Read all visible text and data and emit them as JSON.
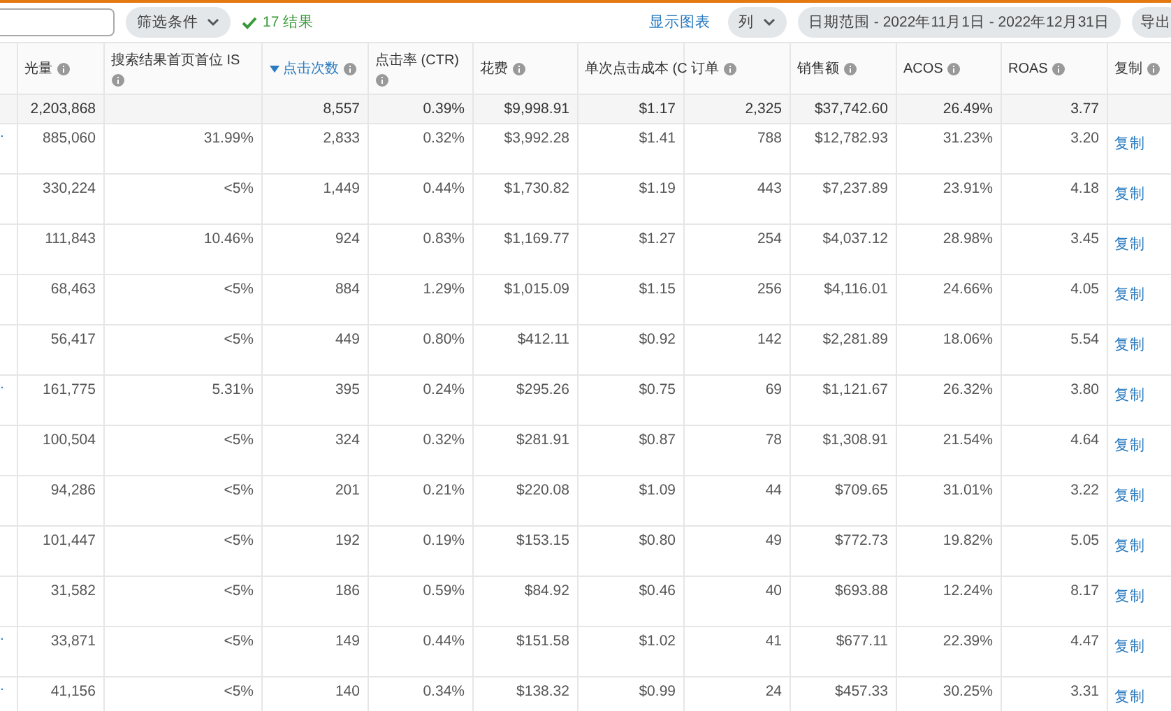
{
  "toolbar": {
    "filter": {
      "label": "筛选条件"
    },
    "result": {
      "text": "17 结果"
    },
    "chart_link": "显示图表",
    "columns_menu": {
      "label": "列"
    },
    "date_range": "日期范围 - 2022年11月1日 - 2022年12月31日",
    "export": "导出"
  },
  "table": {
    "columns": [
      {
        "label": "光量",
        "info": true,
        "sorted": false
      },
      {
        "label": "搜索结果首页首位 IS",
        "info": true,
        "sorted": false
      },
      {
        "label": "点击次数",
        "info": true,
        "sorted": true
      },
      {
        "label": "点击率 (CTR)",
        "info": true,
        "sorted": false
      },
      {
        "label": "花费",
        "info": true,
        "sorted": false
      },
      {
        "label": "单次点击成本 (C",
        "info": false,
        "sorted": false
      },
      {
        "label": "订单",
        "info": true,
        "sorted": false
      },
      {
        "label": "销售额",
        "info": true,
        "sorted": false
      },
      {
        "label": "ACOS",
        "info": true,
        "sorted": false
      },
      {
        "label": "ROAS",
        "info": true,
        "sorted": false
      },
      {
        "label": "复制",
        "info": true,
        "sorted": false
      }
    ],
    "totals": {
      "first": "2,203,868",
      "rest": [
        "8,557",
        "0.39%",
        "$9,998.91",
        "$1.17",
        "2,325",
        "$37,742.60",
        "26.49%",
        "3.77"
      ]
    },
    "rows": [
      {
        "lead": ".",
        "cells": [
          "885,060",
          "31.99%",
          "2,833",
          "0.32%",
          "$3,992.28",
          "$1.41",
          "788",
          "$12,782.93",
          "31.23%",
          "3.20"
        ],
        "action": "复制"
      },
      {
        "cells": [
          "330,224",
          "<5%",
          "1,449",
          "0.44%",
          "$1,730.82",
          "$1.19",
          "443",
          "$7,237.89",
          "23.91%",
          "4.18"
        ],
        "action": "复制"
      },
      {
        "cells": [
          "111,843",
          "10.46%",
          "924",
          "0.83%",
          "$1,169.77",
          "$1.27",
          "254",
          "$4,037.12",
          "28.98%",
          "3.45"
        ],
        "action": "复制"
      },
      {
        "cells": [
          "68,463",
          "<5%",
          "884",
          "1.29%",
          "$1,015.09",
          "$1.15",
          "256",
          "$4,116.01",
          "24.66%",
          "4.05"
        ],
        "action": "复制"
      },
      {
        "cells": [
          "56,417",
          "<5%",
          "449",
          "0.80%",
          "$412.11",
          "$0.92",
          "142",
          "$2,281.89",
          "18.06%",
          "5.54"
        ],
        "action": "复制"
      },
      {
        "lead": ".",
        "cells": [
          "161,775",
          "5.31%",
          "395",
          "0.24%",
          "$295.26",
          "$0.75",
          "69",
          "$1,121.67",
          "26.32%",
          "3.80"
        ],
        "action": "复制"
      },
      {
        "cells": [
          "100,504",
          "<5%",
          "324",
          "0.32%",
          "$281.91",
          "$0.87",
          "78",
          "$1,308.91",
          "21.54%",
          "4.64"
        ],
        "action": "复制"
      },
      {
        "cells": [
          "94,286",
          "<5%",
          "201",
          "0.21%",
          "$220.08",
          "$1.09",
          "44",
          "$709.65",
          "31.01%",
          "3.22"
        ],
        "action": "复制"
      },
      {
        "cells": [
          "101,447",
          "<5%",
          "192",
          "0.19%",
          "$153.15",
          "$0.80",
          "49",
          "$772.73",
          "19.82%",
          "5.05"
        ],
        "action": "复制"
      },
      {
        "cells": [
          "31,582",
          "<5%",
          "186",
          "0.59%",
          "$84.92",
          "$0.46",
          "40",
          "$693.88",
          "12.24%",
          "8.17"
        ],
        "action": "复制"
      },
      {
        "lead": ".",
        "cells": [
          "33,871",
          "<5%",
          "149",
          "0.44%",
          "$151.58",
          "$1.02",
          "41",
          "$677.11",
          "22.39%",
          "4.47"
        ],
        "action": "复制"
      },
      {
        "lead": ".",
        "cells": [
          "41,156",
          "<5%",
          "140",
          "0.34%",
          "$138.32",
          "$0.99",
          "24",
          "$457.33",
          "30.25%",
          "3.31"
        ],
        "action": "复制"
      }
    ]
  }
}
